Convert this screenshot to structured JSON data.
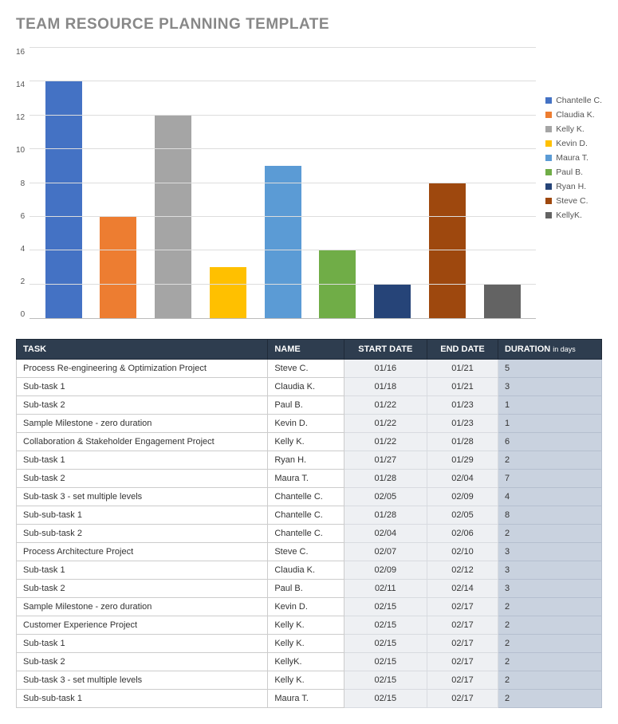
{
  "title": "TEAM RESOURCE PLANNING TEMPLATE",
  "chart_data": {
    "type": "bar",
    "ylim": [
      0,
      16
    ],
    "yticks": [
      0,
      2,
      4,
      6,
      8,
      10,
      12,
      14,
      16
    ],
    "series": [
      {
        "name": "Chantelle C.",
        "value": 14,
        "color": "#4472c4"
      },
      {
        "name": "Claudia K.",
        "value": 6,
        "color": "#ed7d31"
      },
      {
        "name": "Kelly K.",
        "value": 12,
        "color": "#a5a5a5"
      },
      {
        "name": "Kevin D.",
        "value": 3,
        "color": "#ffc000"
      },
      {
        "name": "Maura T.",
        "value": 9,
        "color": "#5b9bd5"
      },
      {
        "name": "Paul B.",
        "value": 4,
        "color": "#70ad47"
      },
      {
        "name": "Ryan H.",
        "value": 2,
        "color": "#264478"
      },
      {
        "name": "Steve C.",
        "value": 8,
        "color": "#9e480e"
      },
      {
        "name": "KellyK.",
        "value": 2,
        "color": "#636363"
      }
    ]
  },
  "table": {
    "headers": {
      "task": "TASK",
      "name": "NAME",
      "start": "START DATE",
      "end": "END DATE",
      "duration": "DURATION",
      "duration_sub": "in days"
    },
    "rows": [
      {
        "task": "Process Re-engineering & Optimization Project",
        "name": "Steve C.",
        "start": "01/16",
        "end": "01/21",
        "duration": "5"
      },
      {
        "task": "Sub-task 1",
        "name": "Claudia K.",
        "start": "01/18",
        "end": "01/21",
        "duration": "3"
      },
      {
        "task": "Sub-task 2",
        "name": "Paul B.",
        "start": "01/22",
        "end": "01/23",
        "duration": "1"
      },
      {
        "task": "Sample Milestone - zero duration",
        "name": "Kevin D.",
        "start": "01/22",
        "end": "01/23",
        "duration": "1"
      },
      {
        "task": "Collaboration & Stakeholder Engagement Project",
        "name": "Kelly K.",
        "start": "01/22",
        "end": "01/28",
        "duration": "6"
      },
      {
        "task": "Sub-task 1",
        "name": "Ryan H.",
        "start": "01/27",
        "end": "01/29",
        "duration": "2"
      },
      {
        "task": "Sub-task 2",
        "name": "Maura T.",
        "start": "01/28",
        "end": "02/04",
        "duration": "7"
      },
      {
        "task": "Sub-task 3 - set multiple levels",
        "name": "Chantelle C.",
        "start": "02/05",
        "end": "02/09",
        "duration": "4"
      },
      {
        "task": "Sub-sub-task 1",
        "name": "Chantelle C.",
        "start": "01/28",
        "end": "02/05",
        "duration": "8"
      },
      {
        "task": "Sub-sub-task 2",
        "name": "Chantelle C.",
        "start": "02/04",
        "end": "02/06",
        "duration": "2"
      },
      {
        "task": "Process Architecture Project",
        "name": "Steve C.",
        "start": "02/07",
        "end": "02/10",
        "duration": "3"
      },
      {
        "task": "Sub-task 1",
        "name": "Claudia K.",
        "start": "02/09",
        "end": "02/12",
        "duration": "3"
      },
      {
        "task": "Sub-task 2",
        "name": "Paul B.",
        "start": "02/11",
        "end": "02/14",
        "duration": "3"
      },
      {
        "task": "Sample Milestone - zero duration",
        "name": "Kevin D.",
        "start": "02/15",
        "end": "02/17",
        "duration": "2"
      },
      {
        "task": "Customer Experience Project",
        "name": "Kelly K.",
        "start": "02/15",
        "end": "02/17",
        "duration": "2"
      },
      {
        "task": "Sub-task 1",
        "name": "Kelly K.",
        "start": "02/15",
        "end": "02/17",
        "duration": "2"
      },
      {
        "task": "Sub-task 2",
        "name": "KellyK.",
        "start": "02/15",
        "end": "02/17",
        "duration": "2"
      },
      {
        "task": "Sub-task 3 - set multiple levels",
        "name": "Kelly K.",
        "start": "02/15",
        "end": "02/17",
        "duration": "2"
      },
      {
        "task": "Sub-sub-task 1",
        "name": "Maura T.",
        "start": "02/15",
        "end": "02/17",
        "duration": "2"
      }
    ]
  }
}
